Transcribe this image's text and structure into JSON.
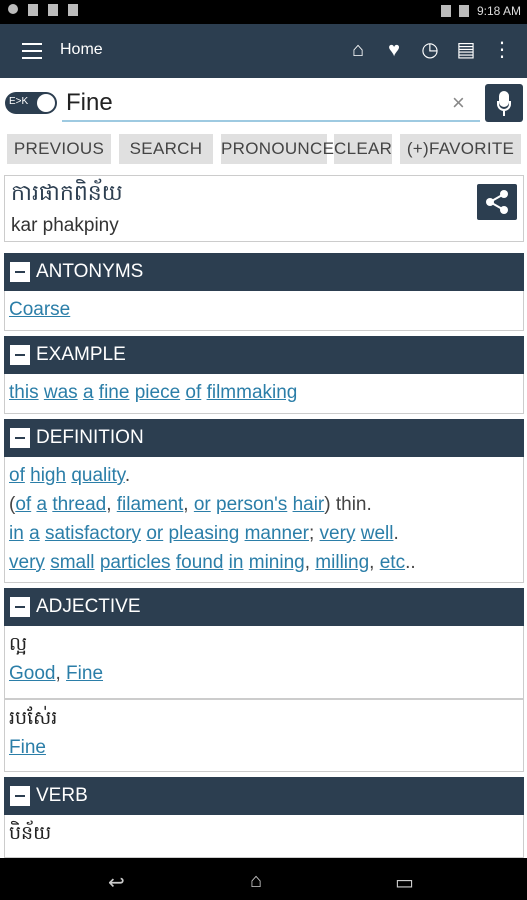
{
  "status": {
    "time": "9:18",
    "ampm": "AM"
  },
  "appbar": {
    "title": "Home"
  },
  "search": {
    "toggle_label": "E>K",
    "value": "Fine"
  },
  "buttons": {
    "previous": "PREVIOUS",
    "search": "SEARCH",
    "pronounce": "PRONOUNCE",
    "clear": "CLEAR",
    "favorite": "(+)FAVORITE"
  },
  "result": {
    "khmer": "ការផាកពិន័យ",
    "romanized": "kar phakpiny"
  },
  "sections": {
    "antonyms": {
      "title": "ANTONYMS",
      "words": [
        "Coarse"
      ]
    },
    "example": {
      "title": "EXAMPLE",
      "words": [
        "this",
        "was",
        "a",
        "fine",
        "piece",
        "of",
        "filmmaking"
      ]
    },
    "definition": {
      "title": "DEFINITION",
      "line1": [
        "of",
        "high",
        "quality"
      ],
      "line1_end": ".",
      "line2_open": "(",
      "line2": [
        "of",
        "a",
        "thread",
        "filament",
        "or",
        "person's",
        "hair"
      ],
      "line2_end": ") thin.",
      "line3": [
        "in",
        "a",
        "satisfactory",
        "or",
        "pleasing",
        "manner",
        "very",
        "well"
      ],
      "line4": [
        "very",
        "small",
        "particles",
        "found",
        "in",
        "mining",
        "milling",
        "etc"
      ],
      "line4_end": ".."
    },
    "adjective": {
      "title": "ADJECTIVE",
      "entries": [
        {
          "khmer": "ល្អ",
          "words": [
            "Good",
            "Fine"
          ]
        },
        {
          "khmer": "របស់ែរ",
          "words": [
            "Fine"
          ]
        }
      ]
    },
    "verb": {
      "title": "VERB",
      "entries": [
        {
          "khmer": "បិន័យ"
        }
      ]
    }
  }
}
